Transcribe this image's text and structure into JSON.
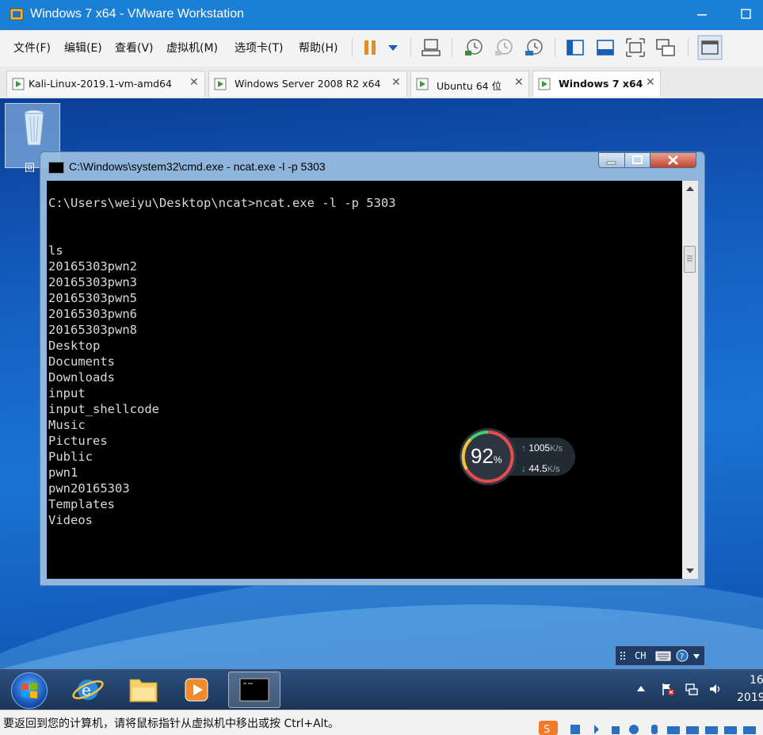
{
  "window": {
    "title": "Windows 7 x64 - VMware Workstation",
    "icon": "vmware-icon"
  },
  "menu": {
    "items": [
      "文件(F)",
      "编辑(E)",
      "查看(V)",
      "虚拟机(M)",
      "选项卡(T)",
      "帮助(H)"
    ]
  },
  "toolbar": {
    "icons": [
      "pause-icon",
      "dropdown-icon",
      "send-ctrl-alt-del-icon",
      "snapshot-take-icon",
      "snapshot-revert-icon",
      "snapshot-manager-icon",
      "library-icon",
      "console-view-icon",
      "fullscreen-icon",
      "unity-icon",
      "thumbnail-icon"
    ]
  },
  "tabs": [
    {
      "label": "Kali-Linux-2019.1-vm-amd64",
      "active": false
    },
    {
      "label": "Windows Server 2008 R2 x64",
      "active": false
    },
    {
      "label": "Ubuntu 64 位",
      "active": false
    },
    {
      "label": "Windows 7 x64",
      "active": true
    }
  ],
  "desktop": {
    "recycle_bin_label": "回"
  },
  "cmd": {
    "title": "C:\\Windows\\system32\\cmd.exe - ncat.exe  -l -p 5303",
    "lines": [
      "C:\\Users\\weiyu\\Desktop\\ncat>ncat.exe -l -p 5303",
      "",
      "",
      "ls",
      "20165303pwn2",
      "20165303pwn3",
      "20165303pwn5",
      "20165303pwn6",
      "20165303pwn8",
      "Desktop",
      "Documents",
      "Downloads",
      "input",
      "input_shellcode",
      "Music",
      "Pictures",
      "Public",
      "pwn1",
      "pwn20165303",
      "Templates",
      "Videos"
    ]
  },
  "net_widget": {
    "percent": "92",
    "percent_unit": "%",
    "up_value": "1005",
    "up_unit": "K/s",
    "down_value": "44.5",
    "down_unit": "K/s"
  },
  "langbar": {
    "label": "CH"
  },
  "taskbar": {
    "apps": [
      "internet-explorer-icon",
      "explorer-folder-icon",
      "media-player-icon",
      "cmd-icon"
    ],
    "clock_time": "16",
    "clock_date": "2019"
  },
  "statusbar": {
    "text": "要返回到您的计算机，请将鼠标指针从虚拟机中移出或按 Ctrl+Alt。"
  },
  "colors": {
    "title_bar": "#1c7fd6",
    "console_bg": "#000000",
    "console_fg": "#d9d9d9"
  }
}
